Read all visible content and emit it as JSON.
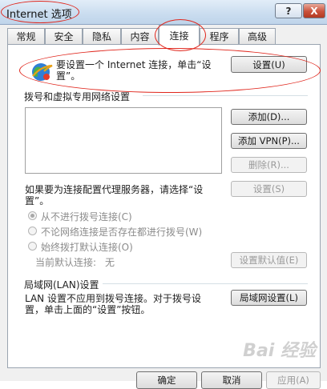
{
  "window": {
    "title": "Internet 选项",
    "help_label": "?",
    "close_label": "X"
  },
  "tabs": [
    {
      "label": "常规"
    },
    {
      "label": "安全"
    },
    {
      "label": "隐私"
    },
    {
      "label": "内容"
    },
    {
      "label": "连接",
      "active": true
    },
    {
      "label": "程序"
    },
    {
      "label": "高级"
    }
  ],
  "setup": {
    "text_line1": "要设置一个 Internet 连接，单击“设",
    "text_line2": "置”。",
    "button": "设置(U)"
  },
  "dialup": {
    "heading": "拨号和虚拟专用网络设置",
    "add_button": "添加(D)...",
    "add_vpn_button": "添加 VPN(P)...",
    "delete_button": "删除(R)...",
    "proxy_text_line1": "如果要为连接配置代理服务器，请选择“设",
    "proxy_text_line2": "置”。",
    "settings_button": "设置(S)",
    "radio_never": "从不进行拨号连接(C)",
    "radio_no_network": "不论网络连接是否存在都进行拨号(W)",
    "radio_always": "始终拨打默认连接(O)",
    "current_default_label": "当前默认连接:",
    "current_default_value": "无",
    "set_default_button": "设置默认值(E)"
  },
  "lan": {
    "heading": "局域网(LAN)设置",
    "text_line1": "LAN 设置不应用到拨号连接。对于拨号设",
    "text_line2": "置，单击上面的“设置”按钮。",
    "button": "局域网设置(L)"
  },
  "footer": {
    "ok": "确定",
    "cancel": "取消",
    "apply": "应用(A)"
  },
  "watermark": "Bai 经验"
}
